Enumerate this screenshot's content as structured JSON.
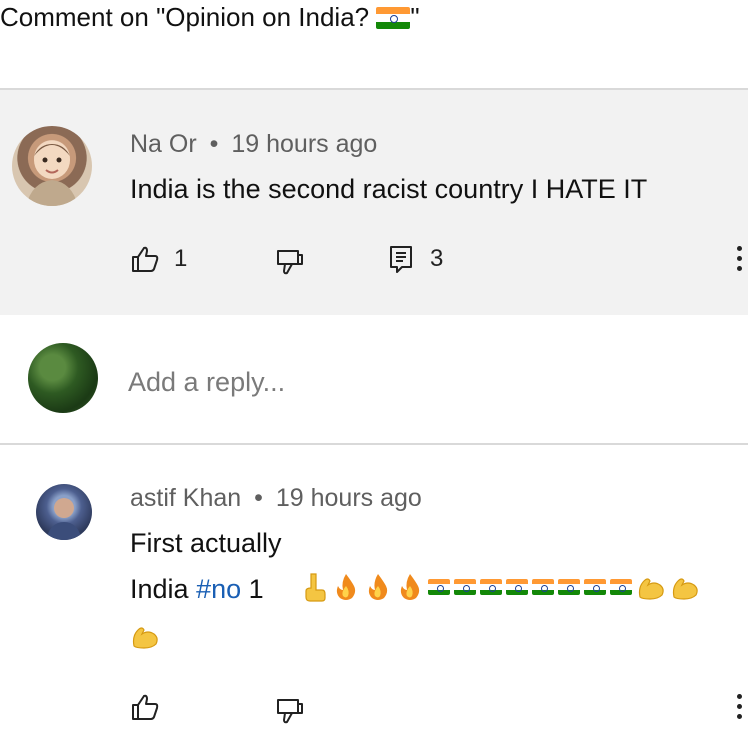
{
  "header": {
    "title_prefix": "Comment on \"Opinion on India? ",
    "title_suffix": "\"",
    "flag_icon": "india-flag-icon"
  },
  "comment1": {
    "author": "Na Or",
    "separator": "•",
    "time": "19 hours ago",
    "text": "India is the second racist country I HATE IT",
    "like_count": "1",
    "reply_count": "3",
    "icons": {
      "like": "thumbs-up-icon",
      "dislike": "thumbs-down-icon",
      "reply": "comment-icon",
      "more": "more-vert-icon"
    }
  },
  "reply_box": {
    "placeholder": "Add a reply..."
  },
  "comment2": {
    "author": "astif Khan",
    "separator": "•",
    "time": "19 hours ago",
    "line1": "First actually",
    "line2_prefix": "India ",
    "hashtag": "#no",
    "line2_suffix": " 1",
    "emojis": [
      "point-down-hand",
      "fire",
      "fire",
      "fire",
      "india-flag",
      "india-flag",
      "india-flag",
      "india-flag",
      "india-flag",
      "india-flag",
      "india-flag",
      "india-flag",
      "flexed-biceps",
      "flexed-biceps",
      "flexed-biceps"
    ]
  },
  "colors": {
    "saffron": "#ff9933",
    "green": "#138808",
    "chakra": "#1c3f94",
    "hashtag": "#1a5fb4"
  }
}
